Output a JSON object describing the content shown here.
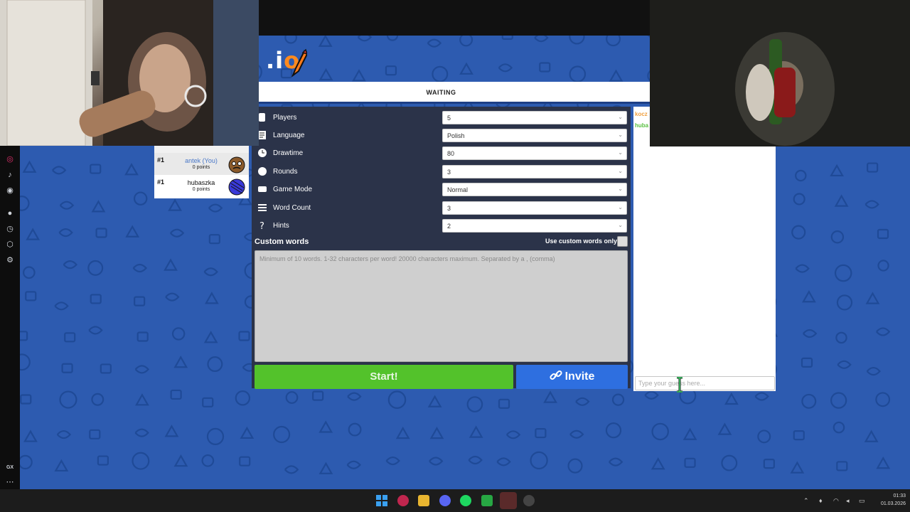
{
  "logo": {
    "text_a": ".i",
    "text_b": "o"
  },
  "status": {
    "text": "WAITING"
  },
  "players": [
    {
      "rank": "#1",
      "name": "antek (You)",
      "points": "0 points"
    },
    {
      "rank": "#1",
      "name": "hubaszka",
      "points": "0 points"
    }
  ],
  "settings": {
    "rows": [
      {
        "label": "Players",
        "value": "5",
        "icon": "user-icon"
      },
      {
        "label": "Language",
        "value": "Polish",
        "icon": "language-icon"
      },
      {
        "label": "Drawtime",
        "value": "80",
        "icon": "clock-icon"
      },
      {
        "label": "Rounds",
        "value": "3",
        "icon": "rounds-icon"
      },
      {
        "label": "Game Mode",
        "value": "Normal",
        "icon": "gamemode-icon"
      },
      {
        "label": "Word Count",
        "value": "3",
        "icon": "wordcount-icon"
      },
      {
        "label": "Hints",
        "value": "2",
        "icon": "hint-icon"
      }
    ],
    "custom_words_label": "Custom words",
    "use_custom_only_label": "Use custom words only",
    "custom_words_placeholder": "Minimum of 10 words. 1-32 characters per word! 20000 characters maximum. Separated by a , (comma)",
    "start_label": "Start!",
    "invite_label": "Invite"
  },
  "chat": {
    "lines": [
      {
        "text": "kocz",
        "color": "#f0a040"
      },
      {
        "text": "huba",
        "color": "#58c040"
      }
    ],
    "input_placeholder": "Type your guess here..."
  },
  "taskbar": {
    "time": "01:33",
    "date": "01.03.2026",
    "gx_label": "GX"
  },
  "colors": {
    "background": "#2d5bb0",
    "start_button": "#53c22b",
    "invite_button": "#2e6fe0",
    "settings_panel": "#2b3349"
  }
}
